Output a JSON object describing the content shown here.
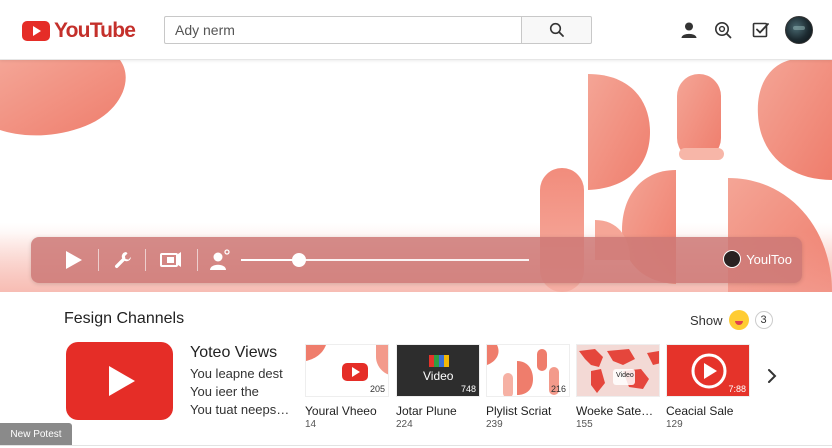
{
  "header": {
    "logo_text": "YouTube",
    "search_placeholder": "Ady nerm",
    "icons": [
      "account-icon",
      "search-circle-icon",
      "checkbox-icon"
    ]
  },
  "player": {
    "progress": 0.2,
    "brand_label": "YoulToo",
    "controls": [
      "play-icon",
      "wrench-icon",
      "cast-icon",
      "person-icon"
    ]
  },
  "section": {
    "title": "Fesign Channels",
    "show_label": "Show",
    "show_count": "3"
  },
  "featured": {
    "title": "Yoteo Views",
    "lines": [
      "You leapne dest",
      "You ieer the",
      "You tuat neeps…"
    ]
  },
  "cards": [
    {
      "title": "Youral Vheeo",
      "sub": "14",
      "duration": "205",
      "thumb_label": ""
    },
    {
      "title": "Jotar Plune",
      "sub": "224",
      "duration": "748",
      "thumb_label": "Video"
    },
    {
      "title": "Plylist Scriat",
      "sub": "239",
      "duration": "216",
      "thumb_label": ""
    },
    {
      "title": "Woeke Sate…",
      "sub": "155",
      "duration": "",
      "thumb_label": "Video"
    },
    {
      "title": "Ceacial Sale",
      "sub": "129",
      "duration": "7:88",
      "thumb_label": ""
    }
  ],
  "footer": {
    "new_post_label": "New Potest"
  },
  "colors": {
    "brand_red": "#e52d27",
    "hero_coral": "#f28a7c",
    "player_bar": "#cd7876"
  }
}
